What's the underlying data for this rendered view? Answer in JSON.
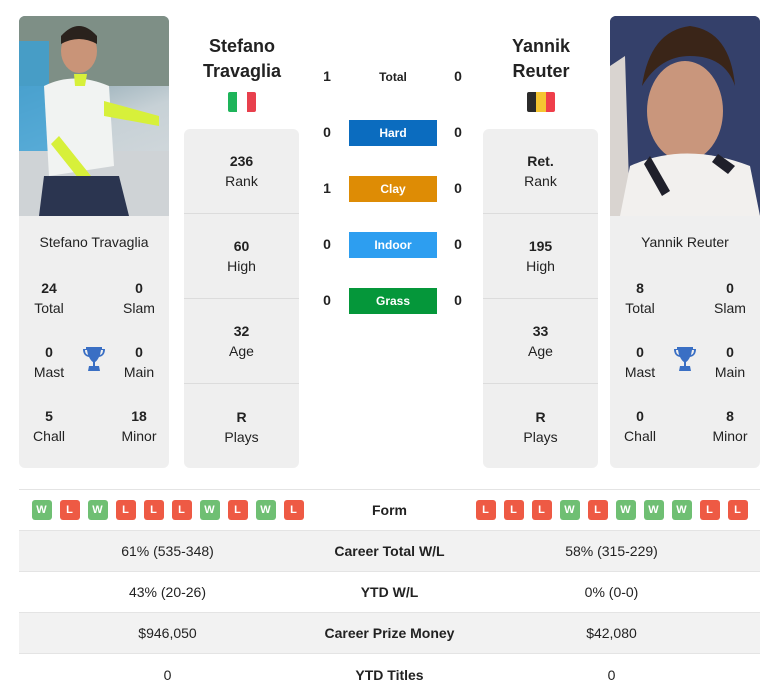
{
  "player1": {
    "header_first": "Stefano",
    "header_last": "Travaglia",
    "full_name": "Stefano Travaglia",
    "flag": [
      "#1eb45a",
      "#ffffff",
      "#e8404d"
    ],
    "country_icon": "italy-flag-icon",
    "titles": {
      "total": {
        "value": "24",
        "label": "Total"
      },
      "slam": {
        "value": "0",
        "label": "Slam"
      },
      "mast": {
        "value": "0",
        "label": "Mast"
      },
      "main": {
        "value": "0",
        "label": "Main"
      },
      "chall": {
        "value": "5",
        "label": "Chall"
      },
      "minor": {
        "value": "18",
        "label": "Minor"
      }
    },
    "stats": [
      {
        "value": "236",
        "label": "Rank"
      },
      {
        "value": "60",
        "label": "High"
      },
      {
        "value": "32",
        "label": "Age"
      },
      {
        "value": "R",
        "label": "Plays"
      }
    ],
    "form": [
      "W",
      "L",
      "W",
      "L",
      "L",
      "L",
      "W",
      "L",
      "W",
      "L"
    ],
    "career_wl": "61% (535-348)",
    "ytd_wl": "43% (20-26)",
    "prize_money": "$946,050",
    "ytd_titles": "0"
  },
  "player2": {
    "header_first": "Yannik",
    "header_last": "Reuter",
    "full_name": "Yannik Reuter",
    "flag": [
      "#2b2b2b",
      "#f5c531",
      "#ef3e4a"
    ],
    "country_icon": "belgium-flag-icon",
    "titles": {
      "total": {
        "value": "8",
        "label": "Total"
      },
      "slam": {
        "value": "0",
        "label": "Slam"
      },
      "mast": {
        "value": "0",
        "label": "Mast"
      },
      "main": {
        "value": "0",
        "label": "Main"
      },
      "chall": {
        "value": "0",
        "label": "Chall"
      },
      "minor": {
        "value": "8",
        "label": "Minor"
      }
    },
    "stats": [
      {
        "value": "Ret.",
        "label": "Rank"
      },
      {
        "value": "195",
        "label": "High"
      },
      {
        "value": "33",
        "label": "Age"
      },
      {
        "value": "R",
        "label": "Plays"
      }
    ],
    "form": [
      "L",
      "L",
      "L",
      "W",
      "L",
      "W",
      "W",
      "W",
      "L",
      "L"
    ],
    "career_wl": "58% (315-229)",
    "ytd_wl": "0% (0-0)",
    "prize_money": "$42,080",
    "ytd_titles": "0"
  },
  "h2h": [
    {
      "label": "Total",
      "p1": "1",
      "p2": "0",
      "color": ""
    },
    {
      "label": "Hard",
      "p1": "0",
      "p2": "0",
      "color": "#0b6cbf"
    },
    {
      "label": "Clay",
      "p1": "1",
      "p2": "0",
      "color": "#de8c05"
    },
    {
      "label": "Indoor",
      "p1": "0",
      "p2": "0",
      "color": "#2d9ef0"
    },
    {
      "label": "Grass",
      "p1": "0",
      "p2": "0",
      "color": "#05973a"
    }
  ],
  "table_labels": {
    "form": "Form",
    "career_wl": "Career Total W/L",
    "ytd_wl": "YTD W/L",
    "prize_money": "Career Prize Money",
    "ytd_titles": "YTD Titles"
  },
  "colors": {
    "win": "#6fbf73",
    "loss": "#ee5a44",
    "trophy": "#3a6fc4",
    "card_bg": "#efefef"
  }
}
